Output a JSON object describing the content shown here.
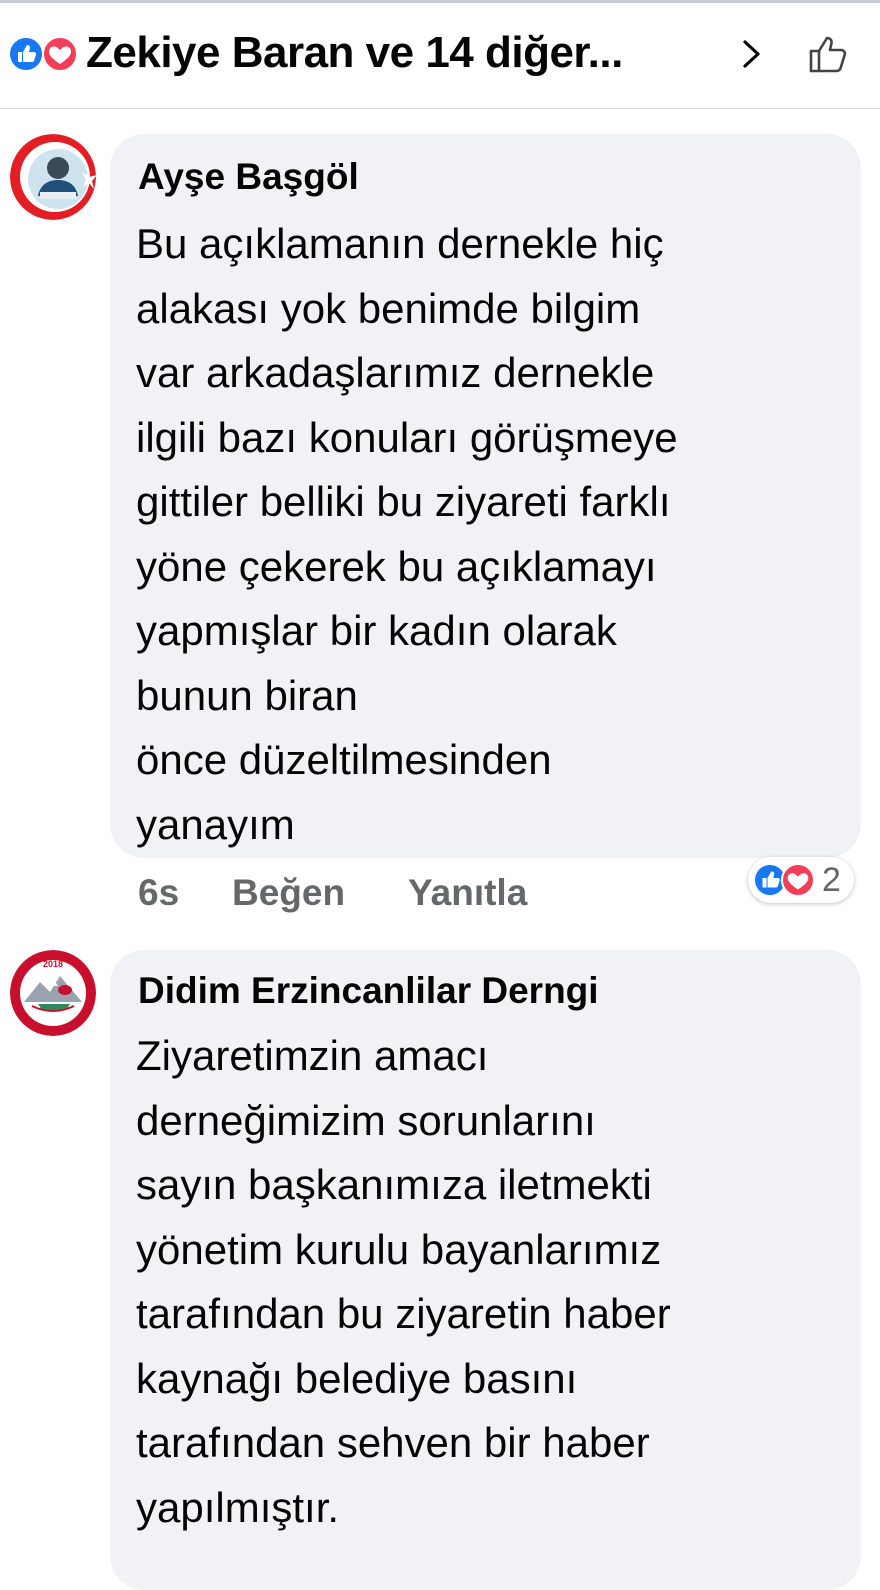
{
  "header": {
    "title": "Zekiye Baran ve 14 diğer...",
    "reaction_icons": [
      "like-icon",
      "love-icon"
    ],
    "chevron_icon": "chevron-right-icon",
    "like_button_icon": "thumbs-up-icon"
  },
  "comments": [
    {
      "author": "Ayşe Başgöl",
      "text": "Bu açıklamanın dernekle hiç\nalakası yok benimde bilgim\nvar arkadaşlarımız dernekle\nilgili bazı konuları görüşmeye\ngittiler belliki bu ziyareti farklı\nyöne çekerek  bu açıklamayı\nyapmışlar bir kadın olarak\nbunun biran\n önce düzeltilmesinden\nyanayım",
      "time": "6s",
      "like_label": "Beğen",
      "reply_label": "Yanıtla",
      "reaction_count": "2"
    },
    {
      "author": "Didim Erzincanlilar Derngi",
      "avatar_logo_text": "2018",
      "text": "Ziyaretimzin amacı\nderneğimizim sorunlarını\nsayın başkanımıza iletmekti\nyönetim kurulu bayanlarımız\ntarafından bu ziyaretin haber\nkaynağı belediye basını\ntarafından sehven bir haber\nyapılmıştır."
    }
  ],
  "colors": {
    "like_blue": "#1877f2",
    "love_red": "#f33e58",
    "bubble_bg": "#f0f2f5",
    "meta_gray": "#65676b"
  }
}
